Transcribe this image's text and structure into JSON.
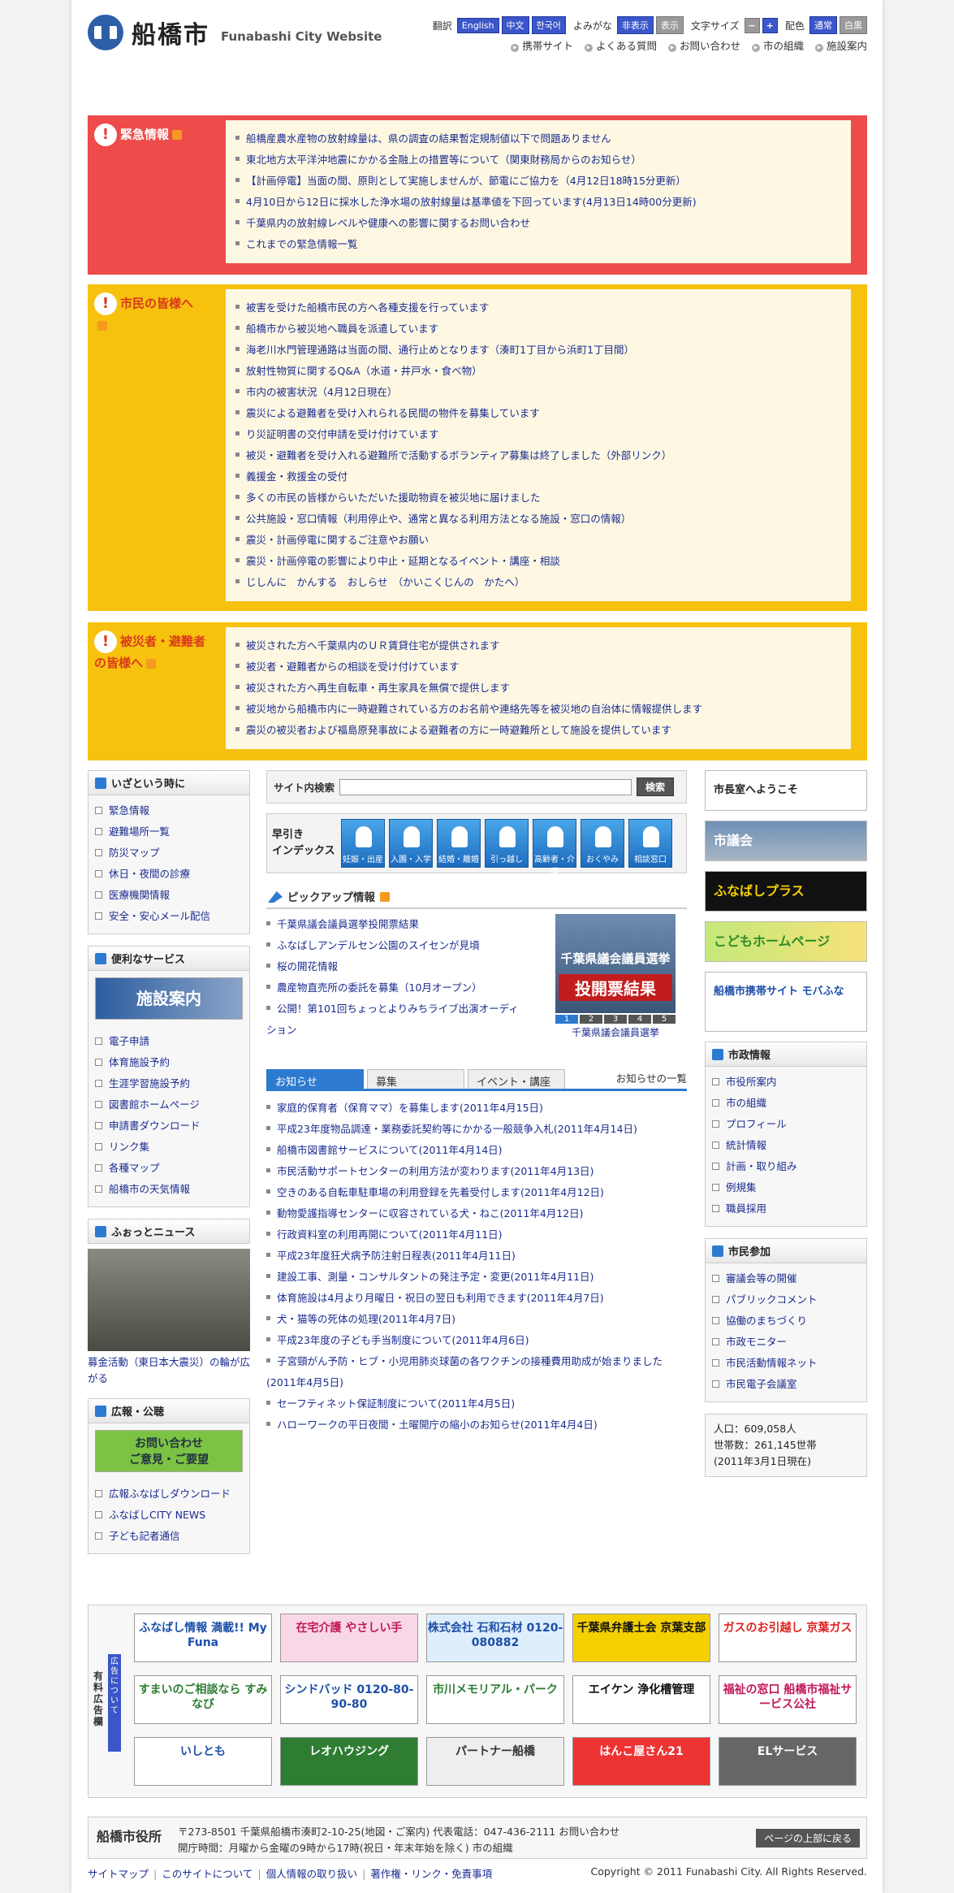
{
  "header": {
    "logo_jp": "船橋市",
    "logo_en": "Funabashi City Website",
    "translate_label": "翻訳",
    "languages": [
      "English",
      "中文",
      "한국어"
    ],
    "yomigana_label": "よみがな",
    "yomigana_show": "非表示",
    "yomigana_hide": "表示",
    "fontsize_label": "文字サイズ",
    "fontsize_minus": "−",
    "fontsize_plus": "+",
    "color_label": "配色",
    "color_normal": "通常",
    "color_bw": "白黒",
    "links": [
      "携帯サイト",
      "よくある質問",
      "お問い合わせ",
      "市の組織",
      "施設案内"
    ]
  },
  "emergency": {
    "title": "緊急情報",
    "items": [
      "船橋産農水産物の放射線量は、県の調査の結果暫定規制値以下で問題ありません",
      "東北地方太平洋沖地震にかかる金融上の措置等について（関東財務局からのお知らせ）",
      "【計画停電】当面の間、原則として実施しませんが、節電にご協力を（4月12日18時15分更新）",
      "4月10日から12日に採水した浄水場の放射線量は基準値を下回っています(4月13日14時00分更新)",
      "千葉県内の放射線レベルや健康への影響に関するお問い合わせ",
      "これまでの緊急情報一覧"
    ]
  },
  "citizens": {
    "title": "市民の皆様へ",
    "items": [
      "被害を受けた船橋市民の方へ各種支援を行っています",
      "船橋市から被災地へ職員を派遣しています",
      "海老川水門管理通路は当面の間、通行止めとなります（湊町1丁目から浜町1丁目間）",
      "放射性物質に関するQ&A（水道・井戸水・食べ物）",
      "市内の被害状況（4月12日現在）",
      "震災による避難者を受け入れられる民間の物件を募集しています",
      "り災証明書の交付申請を受け付けています",
      "被災・避難者を受け入れる避難所で活動するボランティア募集は終了しました（外部リンク）",
      "義援金・救援金の受付",
      "多くの市民の皆様からいただいた援助物資を被災地に届けました",
      "公共施設・窓口情報（利用停止や、通常と異なる利用方法となる施設・窓口の情報）",
      "震災・計画停電に関するご注意やお願い",
      "震災・計画停電の影響により中止・延期となるイベント・講座・相談",
      "じしんに　かんする　おしらせ　（かいこくじんの　かたへ）"
    ]
  },
  "evacuees": {
    "title": "被災者・避難者の皆様へ",
    "items": [
      "被災された方へ千葉県内のＵＲ賃貸住宅が提供されます",
      "被災者・避難者からの相談を受け付けています",
      "被災された方へ再生自転車・再生家具を無償で提供します",
      "被災地から船橋市内に一時避難されている方のお名前や連絡先等を被災地の自治体に情報提供します",
      "震災の被災者および福島原発事故による避難者の方に一時避難所として施設を提供しています"
    ]
  },
  "left": {
    "emergency_head": "いざという時に",
    "emergency_items": [
      "緊急情報",
      "避難場所一覧",
      "防災マップ",
      "休日・夜間の診療",
      "医療機関情報",
      "安全・安心メール配信"
    ],
    "services_head": "便利なサービス",
    "services_banner": "施設案内",
    "services_items": [
      "電子申請",
      "体育施設予約",
      "生涯学習施設予約",
      "図書館ホームページ",
      "申請書ダウンロード",
      "リンク集",
      "各種マップ",
      "船橋市の天気情報"
    ],
    "news_head": "ふぉっとニュース",
    "news_caption": "募金活動（東日本大震災）の輪が広がる",
    "pr_head": "広報・公聴",
    "pr_banner_line1": "お問い合わせ",
    "pr_banner_line2": "ご意見・ご要望",
    "pr_items": [
      "広報ふなばしダウンロード",
      "ふなばしCITY NEWS",
      "子ども記者通信"
    ]
  },
  "center": {
    "search_label": "サイト内検索",
    "search_button": "検索",
    "quick_title_1": "早引き",
    "quick_title_2": "インデックス",
    "quick_items": [
      "妊娠・出産",
      "入園・入学",
      "結婚・離婚",
      "引っ越し",
      "高齢者・介護",
      "おくやみ",
      "相談窓口"
    ],
    "pickup_head": "ピックアップ情報",
    "pickup_items": [
      "千葉県議会議員選挙投開票結果",
      "ふなばしアンデルセン公園のスイセンが見頃",
      "桜の開花情報",
      "農産物直売所の委託を募集（10月オープン）",
      "公開！第101回ちょっとよりみちライブ出演オーディション"
    ],
    "election_line1": "千葉県議会議員選挙",
    "election_line2": "投開票結果",
    "election_pages": [
      "1",
      "2",
      "3",
      "4",
      "5"
    ],
    "election_caption": "千葉県議会議員選挙",
    "tabs": [
      "お知らせ",
      "募集",
      "イベント・講座"
    ],
    "news_more": "お知らせの一覧",
    "news_items": [
      "家庭的保育者（保育ママ）を募集します(2011年4月15日)",
      "平成23年度物品調達・業務委託契約等にかかる一般競争入札(2011年4月14日)",
      "船橋市図書館サービスについて(2011年4月14日)",
      "市民活動サポートセンターの利用方法が変わります(2011年4月13日)",
      "空きのある自転車駐車場の利用登録を先着受付します(2011年4月12日)",
      "動物愛護指導センターに収容されている犬・ねこ(2011年4月12日)",
      "行政資料室の利用再開について(2011年4月11日)",
      "平成23年度狂犬病予防注射日程表(2011年4月11日)",
      "建設工事、測量・コンサルタントの発注予定・変更(2011年4月11日)",
      "体育施設は4月より月曜日・祝日の翌日も利用できます(2011年4月7日)",
      "犬・猫等の死体の処理(2011年4月7日)",
      "平成23年度の子ども手当制度について(2011年4月6日)",
      "子宮頸がん予防・ヒブ・小児用肺炎球菌の各ワクチンの接種費用助成が始まりました(2011年4月5日)",
      "セーフティネット保証制度について(2011年4月5日)",
      "ハローワークの平日夜間・土曜開庁の縮小のお知らせ(2011年4月4日)"
    ]
  },
  "right": {
    "mayor": "市長室へようこそ",
    "council": "市議会",
    "plus": "ふなばしプラス",
    "kids": "こどもホームページ",
    "mobile": "船橋市携帯サイト モバふな",
    "gov_head": "市政情報",
    "gov_items": [
      "市役所案内",
      "市の組織",
      "プロフィール",
      "統計情報",
      "計画・取り組み",
      "例規集",
      "職員採用"
    ],
    "part_head": "市民参加",
    "part_items": [
      "審議会等の開催",
      "パブリックコメント",
      "協働のまちづくり",
      "市政モニター",
      "市民活動情報ネット",
      "市民電子会議室"
    ],
    "population": "人口：609,058人",
    "households": "世帯数：261,145世帯",
    "as_of": "(2011年3月1日現在)"
  },
  "ads": {
    "label": "有料広告欄",
    "about": "広告について",
    "items": [
      "ふなばし情報 満載!! My Funa",
      "在宅介護 やさしい手",
      "株式会社 石和石材 0120-080882",
      "千葉県弁護士会 京葉支部",
      "ガスのお引越し 京葉ガス",
      "すまいのご相談なら すみなび",
      "シンドバッド 0120-80-90-80",
      "市川メモリアル・パーク",
      "エイケン 浄化槽管理",
      "福祉の窓口 船橋市福祉サービス公社",
      "いしとも",
      "レオハウジング",
      "パートナー船橋",
      "はんこ屋さん21",
      "ELサービス"
    ]
  },
  "footer": {
    "org": "船橋市役所",
    "address": "〒273-8501 千葉県船橋市湊町2-10-25(地図・ご案内) 代表電話：047-436-2111 お問い合わせ",
    "hours": "開庁時間：月曜から金曜の9時から17時(祝日・年末年始を除く) 市の組織",
    "top": "ページの上部に戻る",
    "links": [
      "サイトマップ",
      "このサイトについて",
      "個人情報の取り扱い",
      "著作権・リンク・免責事項"
    ],
    "copyright": "Copyright © 2011 Funabashi City. All Rights Reserved."
  }
}
